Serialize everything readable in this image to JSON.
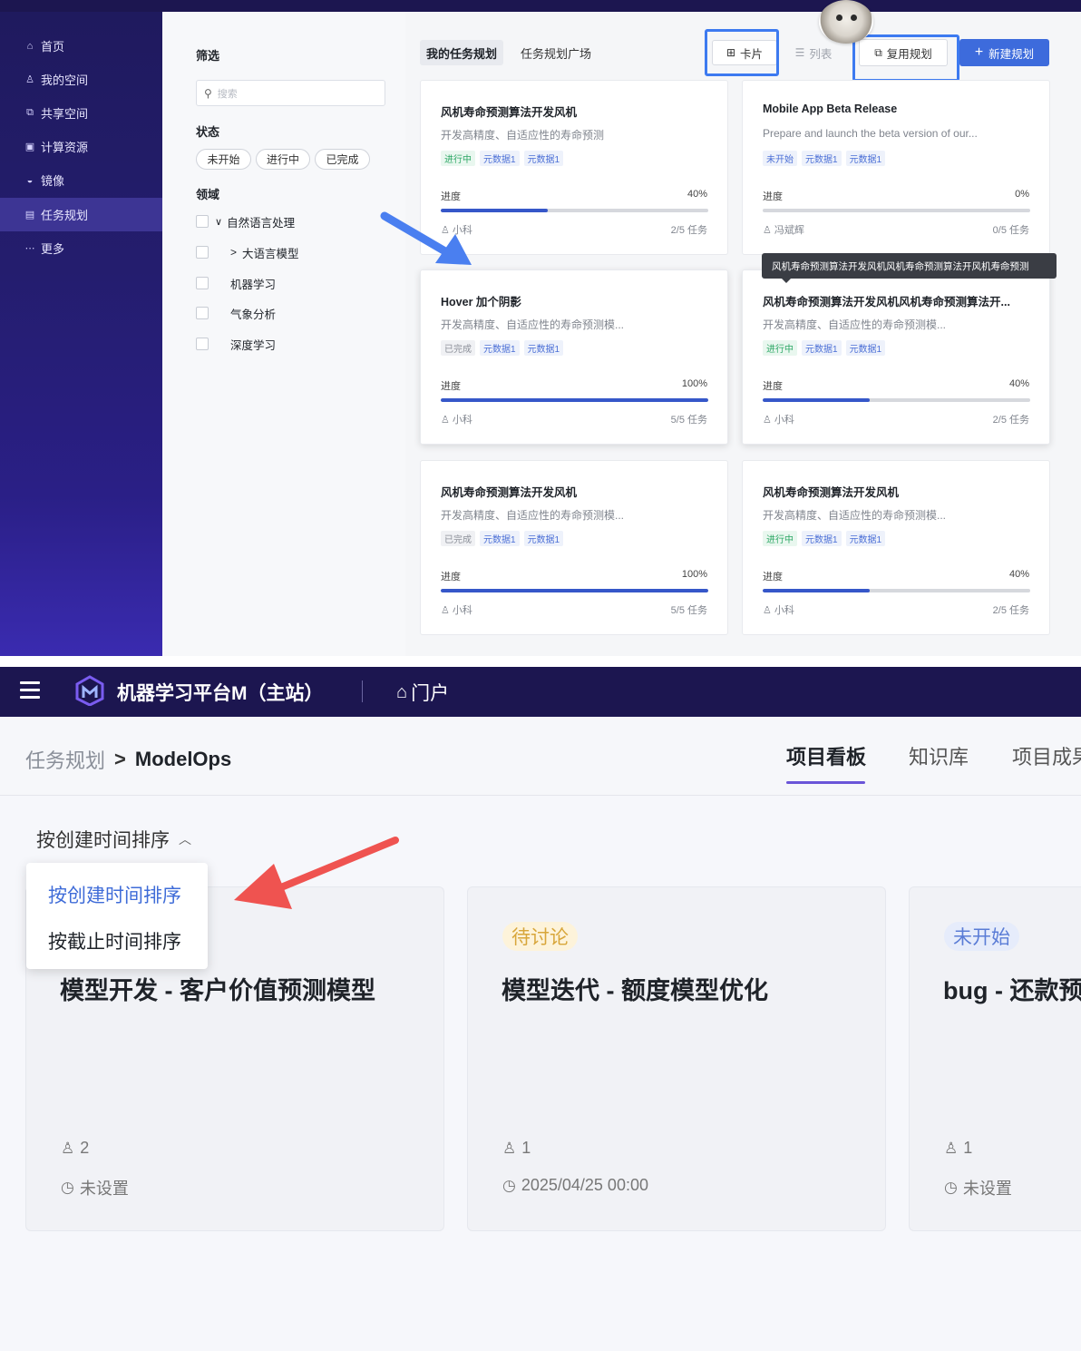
{
  "top": {
    "sidebar": {
      "items": [
        {
          "label": "首页",
          "icon": "home-icon"
        },
        {
          "label": "我的空间",
          "icon": "user-icon"
        },
        {
          "label": "共享空间",
          "icon": "share-icon"
        },
        {
          "label": "计算资源",
          "icon": "gpu-icon"
        },
        {
          "label": "镜像",
          "icon": "image-icon"
        },
        {
          "label": "任务规划",
          "icon": "plan-icon",
          "active": true
        },
        {
          "label": "更多",
          "icon": "more-icon"
        }
      ]
    },
    "filter": {
      "title": "筛选",
      "search_placeholder": "搜索",
      "status_title": "状态",
      "status_chips": [
        "未开始",
        "进行中",
        "已完成"
      ],
      "domain_title": "领域",
      "domains": [
        {
          "label": "自然语言处理",
          "expander": "∨"
        },
        {
          "label": "大语言模型",
          "expander": ">"
        },
        {
          "label": "机器学习",
          "expander": ""
        },
        {
          "label": "气象分析",
          "expander": ""
        },
        {
          "label": "深度学习",
          "expander": ""
        }
      ]
    },
    "tabs": {
      "mine": "我的任务规划",
      "plaza": "任务规划广场"
    },
    "toolbar": {
      "card": "卡片",
      "list": "列表",
      "reuse": "复用规划",
      "new": "新建规划"
    },
    "tooltip": "风机寿命预测算法开发风机风机寿命预测算法开风机寿命预测",
    "cards": [
      {
        "title": "风机寿命预测算法开发风机",
        "desc": "开发高精度、自适应性的寿命预测",
        "status": "进行中",
        "status_class": "s-run",
        "tags": [
          "元数据1",
          "元数据1"
        ],
        "progress_label": "进度",
        "progress_text": "40%",
        "progress": 0.4,
        "owner": "小科",
        "tasks": "2/5 任务",
        "shadow": false
      },
      {
        "title": "Mobile App Beta Release",
        "desc": "Prepare and launch the beta version of our...",
        "status": "未开始",
        "status_class": "s-new",
        "tags": [
          "元数据1",
          "元数据1"
        ],
        "progress_label": "进度",
        "progress_text": "0%",
        "progress": 0.0,
        "owner": "冯斌辉",
        "tasks": "0/5 任务",
        "shadow": false
      },
      {
        "title": "Hover 加个阴影",
        "desc": "开发高精度、自适应性的寿命预测模...",
        "status": "已完成",
        "status_class": "s-done",
        "tags": [
          "元数据1",
          "元数据1"
        ],
        "progress_label": "进度",
        "progress_text": "100%",
        "progress": 1.0,
        "owner": "小科",
        "tasks": "5/5 任务",
        "shadow": true
      },
      {
        "title": "风机寿命预测算法开发风机风机寿命预测算法开...",
        "desc": "开发高精度、自适应性的寿命预测模...",
        "status": "进行中",
        "status_class": "s-run",
        "tags": [
          "元数据1",
          "元数据1"
        ],
        "progress_label": "进度",
        "progress_text": "40%",
        "progress": 0.4,
        "owner": "小科",
        "tasks": "2/5 任务",
        "shadow": true
      },
      {
        "title": "风机寿命预测算法开发风机",
        "desc": "开发高精度、自适应性的寿命预测模...",
        "status": "已完成",
        "status_class": "s-done",
        "tags": [
          "元数据1",
          "元数据1"
        ],
        "progress_label": "进度",
        "progress_text": "100%",
        "progress": 1.0,
        "owner": "小科",
        "tasks": "5/5 任务",
        "shadow": false
      },
      {
        "title": "风机寿命预测算法开发风机",
        "desc": "开发高精度、自适应性的寿命预测模...",
        "status": "进行中",
        "status_class": "s-run",
        "tags": [
          "元数据1",
          "元数据1"
        ],
        "progress_label": "进度",
        "progress_text": "40%",
        "progress": 0.4,
        "owner": "小科",
        "tasks": "2/5 任务",
        "shadow": false
      }
    ]
  },
  "bottom": {
    "app_title": "机器学习平台M（主站）",
    "portal": "门户",
    "breadcrumb": {
      "parent": "任务规划",
      "sep": ">",
      "current": "ModelOps"
    },
    "tabs": [
      "项目看板",
      "知识库",
      "项目成果"
    ],
    "sort_label": "按创建时间排序",
    "sort_options": [
      "按创建时间排序",
      "按截止时间排序"
    ],
    "cards": [
      {
        "badge": "",
        "badge_class": "",
        "title": "模型开发 - 客户价值预测模型",
        "members": "2",
        "deadline": "未设置"
      },
      {
        "badge": "待讨论",
        "badge_class": "pending",
        "title": "模型迭代 - 额度模型优化",
        "members": "1",
        "deadline": "2025/04/25 00:00"
      },
      {
        "badge": "未开始",
        "badge_class": "notstart",
        "title": "bug - 还款预",
        "members": "1",
        "deadline": "未设置"
      }
    ]
  },
  "colors": {
    "accent_blue": "#3d6bdc",
    "highlight_box": "#3d7af0",
    "arrow_blue": "#4a7ff0",
    "arrow_red": "#ef5350",
    "nav_dark": "#1c1650"
  }
}
